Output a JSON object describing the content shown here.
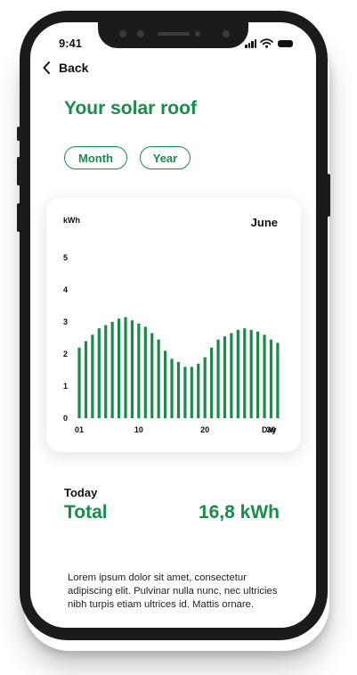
{
  "status_bar": {
    "time": "9:41"
  },
  "nav": {
    "back_label": "Back"
  },
  "page": {
    "title": "Your solar roof"
  },
  "filters": [
    {
      "label": "Month"
    },
    {
      "label": "Year"
    }
  ],
  "chart_data": {
    "type": "bar",
    "period_label": "June",
    "ylabel": "kWh",
    "xlabel": "Day",
    "ylim": [
      0,
      5
    ],
    "yticks": [
      "0",
      "1",
      "2",
      "3",
      "4",
      "5"
    ],
    "xticks": [
      {
        "day": 1,
        "label": "01"
      },
      {
        "day": 10,
        "label": "10"
      },
      {
        "day": 20,
        "label": "20"
      },
      {
        "day": 30,
        "label": "30"
      }
    ],
    "categories": [
      1,
      2,
      3,
      4,
      5,
      6,
      7,
      8,
      9,
      10,
      11,
      12,
      13,
      14,
      15,
      16,
      17,
      18,
      19,
      20,
      21,
      22,
      23,
      24,
      25,
      26,
      27,
      28,
      29,
      30,
      31
    ],
    "values": [
      2.2,
      2.4,
      2.6,
      2.8,
      2.9,
      3.0,
      3.1,
      3.15,
      3.05,
      2.95,
      2.85,
      2.65,
      2.45,
      2.1,
      1.85,
      1.75,
      1.6,
      1.6,
      1.7,
      1.9,
      2.2,
      2.45,
      2.55,
      2.65,
      2.75,
      2.8,
      2.75,
      2.7,
      2.6,
      2.45,
      2.35
    ],
    "bar_color": "#1a8c4a",
    "grid": false
  },
  "summary": {
    "today_label": "Today",
    "total_label": "Total",
    "total_value": "16,8 kWh"
  },
  "description": "Lorem ipsum dolor sit amet, consectetur adipiscing elit. Pulvinar nulla nunc, nec ultricies nibh turpis etiam ultrices id. Mattis ornare.",
  "colors": {
    "accent": "#1a8c4a",
    "device": "#1b1b1b"
  }
}
